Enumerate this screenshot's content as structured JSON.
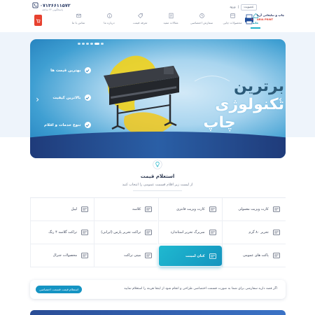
{
  "header": {
    "phone": "۰۷۱۳۶۶۱۱۵۷۲",
    "phone_sub": "پاسخگویی ۲۴ ساعته",
    "login_label": "ورود",
    "register_label": "عضویت",
    "logo_fa": "چاپ و تبلیغاتی آریا",
    "logo_en": "ARIA PRINT",
    "nav": [
      {
        "label": "خانه",
        "icon": "home-icon",
        "active": true
      },
      {
        "label": "محصولات چاپی",
        "icon": "products-icon"
      },
      {
        "label": "سفارش اختصاصی",
        "icon": "custom-order-icon"
      },
      {
        "label": "مقالات مفید",
        "icon": "articles-icon"
      },
      {
        "label": "تعرفه قیمت",
        "icon": "price-icon"
      },
      {
        "label": "درباره ما",
        "icon": "about-icon"
      },
      {
        "label": "تماس با ما",
        "icon": "contact-icon"
      }
    ]
  },
  "hero": {
    "title_line1": "برترین",
    "title_line2": "تکنولوژی",
    "title_line3": "چاپ",
    "features": [
      "بهترین قیمت ها",
      "بالاترین کیفیت",
      "تنوع خدمات و اقلام"
    ],
    "slides": 6,
    "active_slide": 4
  },
  "section": {
    "title": "استعلام قیمت",
    "subtitle": "از لیست زیر اقلام قسمت عمومی را انتخاب کنید"
  },
  "categories": [
    {
      "label": "کارت ویزیت معمولی",
      "icon": "business-card-icon"
    },
    {
      "label": "کارت ویزیت فانتزی",
      "icon": "fancy-card-icon"
    },
    {
      "label": "کلاسه",
      "icon": "folder-icon"
    },
    {
      "label": "لیبل",
      "icon": "label-icon"
    },
    {
      "label": "تحریر ۸۰ گرم",
      "icon": "letter-icon"
    },
    {
      "label": "سربرگ تحریر استاندارد",
      "icon": "letterhead-icon"
    },
    {
      "label": "تراکت تحریر پارس (ایرانی)",
      "icon": "flyer-icon"
    },
    {
      "label": "تراکت گلاسه ۴ رنگ",
      "icon": "glossy-flyer-icon"
    },
    {
      "label": "پاکت های عمومی",
      "icon": "envelope-icon"
    },
    {
      "label": "کتان لمینت",
      "icon": "laminate-icon",
      "active": true
    },
    {
      "label": "مینی تراکت",
      "icon": "mini-flyer-icon"
    },
    {
      "label": "محصولات جنرال",
      "icon": "general-icon"
    }
  ],
  "cta": {
    "text": "اگر قصد دارید سفارشی برای شما به صورت قسمت اختصاصی طراحی و انجام شود از اینجا هزینه را استعلام نمایید",
    "button": "استعلام قیمت قسمت اختصاصی"
  },
  "colors": {
    "accent": "#1db3c9",
    "cart": "#e7412f",
    "navy": "#1f3b7a"
  }
}
